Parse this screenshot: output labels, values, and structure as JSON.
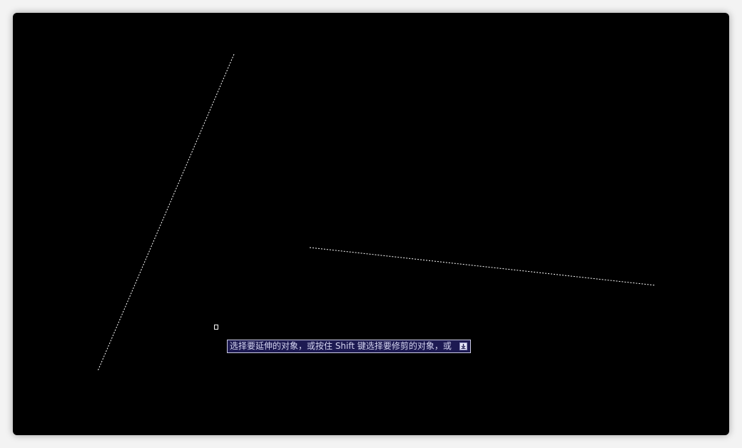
{
  "viewport": {
    "background_color": "#000000",
    "line_color": "#ffffff"
  },
  "entities": [
    {
      "type": "line",
      "style": "dashed"
    },
    {
      "type": "line",
      "style": "dashed"
    }
  ],
  "cursor": {
    "type": "pickbox"
  },
  "dynamic_input": {
    "prompt": "选择要延伸的对象，或按住 Shift 键选择要修剪的对象，或",
    "options_icon": "down-arrow-icon",
    "background_color": "#1d1a52"
  }
}
